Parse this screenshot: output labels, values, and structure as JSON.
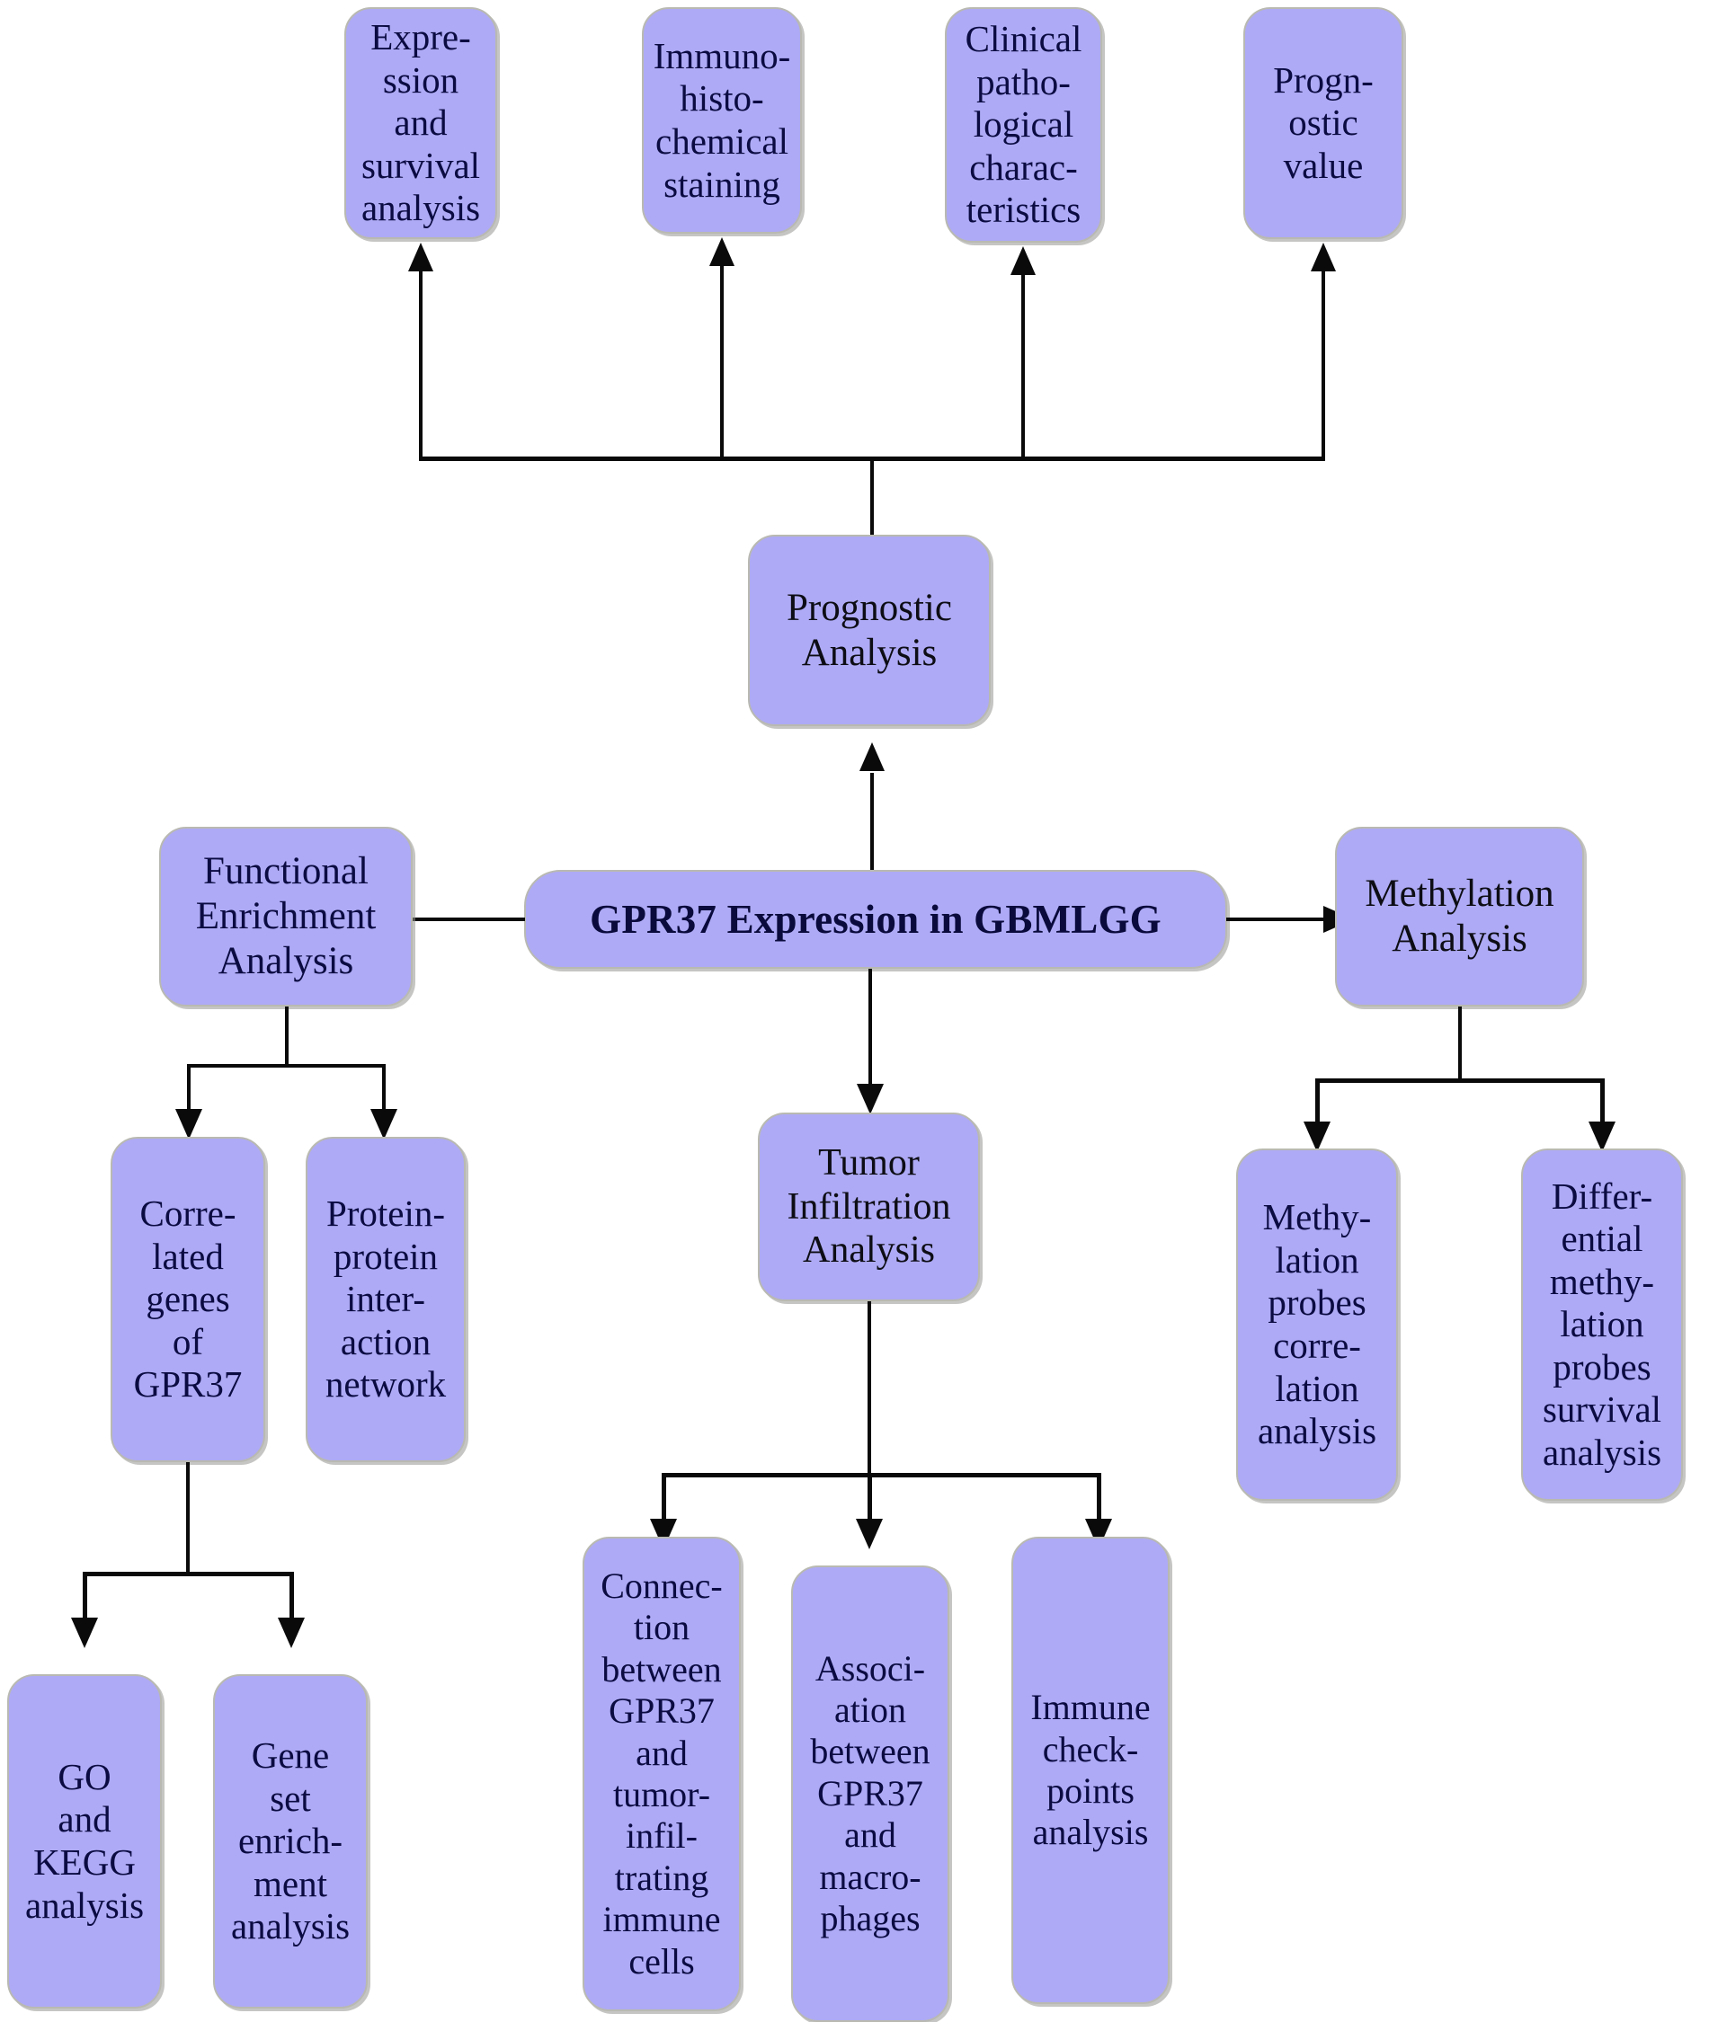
{
  "diagram": {
    "title": "GPR37 Expression in GBMLGG study workflow",
    "colors": {
      "node_fill": "#aeaaf5",
      "node_border": "#b9b9b2",
      "node_text": "#0b0b42",
      "connector": "#0a0a0a",
      "background": "#ffffff"
    }
  },
  "root": {
    "label": "GPR37 Expression in GBMLGG"
  },
  "prognostic": {
    "label": "Prognostic\nAnalysis"
  },
  "top_row": [
    {
      "label": "Expre-\nssion\nand\nsurvival\nanalysis"
    },
    {
      "label": "Immuno-\nhisto-\nchemical\nstaining"
    },
    {
      "label": "Clinical\npatho-\nlogical\ncharac-\nteristics"
    },
    {
      "label": "Progn-\nostic\nvalue"
    }
  ],
  "left_branch": {
    "parent": {
      "label": "Functional\nEnrichment\nAnalysis"
    },
    "children": [
      {
        "label": "Corre-\nlated\ngenes\nof\nGPR37"
      },
      {
        "label": "Protein-\nprotein\ninter-\naction\nnetwork"
      }
    ],
    "grandchildren": [
      {
        "label": "GO\nand\nKEGG\nanalysis"
      },
      {
        "label": "Gene\nset\nenrich-\nment\nanalysis"
      }
    ]
  },
  "center_branch": {
    "parent": {
      "label": "Tumor\nInfiltration\nAnalysis"
    },
    "children": [
      {
        "label": "Connec-\ntion\nbetween\nGPR37\nand\ntumor-\ninfil-\ntrating\nimmune\ncells"
      },
      {
        "label": "Associ-\nation\nbetween\nGPR37\nand\nmacro-\nphages"
      },
      {
        "label": "Immune\ncheck-\npoints\nanalysis"
      }
    ]
  },
  "right_branch": {
    "parent": {
      "label": "Methylation\nAnalysis"
    },
    "children": [
      {
        "label": "Methy-\nlation\nprobes\ncorre-\nlation\nanalysis"
      },
      {
        "label": "Differ-\nential\nmethy-\nlation\nprobes\nsurvival\nanalysis"
      }
    ]
  }
}
